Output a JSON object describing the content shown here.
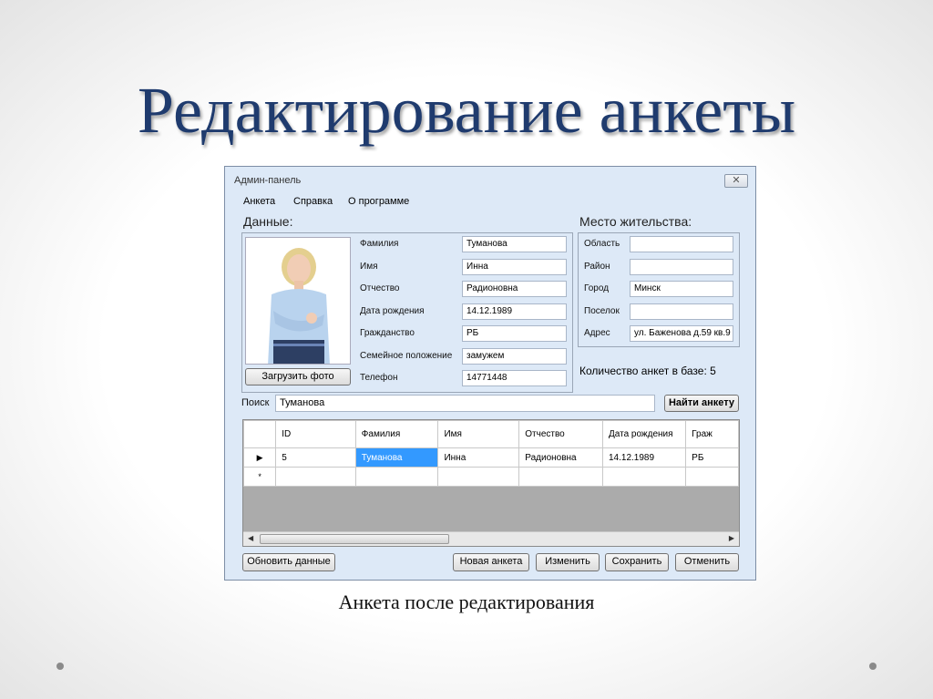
{
  "slide": {
    "title": "Редактирование анкеты",
    "caption": "Анкета после редактирования"
  },
  "window": {
    "title": "Админ-панель",
    "close_icon": "close-icon",
    "close_glyph": "✕"
  },
  "menu": [
    "Анкета",
    "Справка",
    "О программе"
  ],
  "data_group": {
    "label": "Данные:",
    "upload_button": "Загрузить фото",
    "fields": [
      {
        "label": "Фамилия",
        "value": "Туманова"
      },
      {
        "label": "Имя",
        "value": "Инна"
      },
      {
        "label": "Отчество",
        "value": "Радионовна"
      },
      {
        "label": "Дата рождения",
        "value": "14.12.1989"
      },
      {
        "label": "Гражданство",
        "value": "РБ"
      },
      {
        "label": "Семейное положение",
        "value": "замужем"
      },
      {
        "label": "Телефон",
        "value": "14771448"
      }
    ]
  },
  "address_group": {
    "label": "Место жительства:",
    "fields": [
      {
        "label": "Область",
        "value": ""
      },
      {
        "label": "Район",
        "value": ""
      },
      {
        "label": "Город",
        "value": "Минск"
      },
      {
        "label": "Поселок",
        "value": ""
      },
      {
        "label": "Адрес",
        "value": "ул. Баженова д.59 кв.9"
      }
    ]
  },
  "count": {
    "label": "Количество анкет в базе:",
    "value": "5"
  },
  "search": {
    "label": "Поиск",
    "value": "Туманова",
    "button": "Найти анкету"
  },
  "grid": {
    "columns": [
      "ID",
      "Фамилия",
      "Имя",
      "Отчество",
      "Дата рождения",
      "Граж"
    ],
    "rows": [
      {
        "marker": "▶",
        "cells": [
          "5",
          "Туманова",
          "Инна",
          "Радионовна",
          "14.12.1989",
          "РБ"
        ]
      },
      {
        "marker": "*",
        "cells": [
          "",
          "",
          "",
          "",
          "",
          ""
        ]
      }
    ]
  },
  "buttons": {
    "refresh": "Обновить данные",
    "new": "Новая анкета",
    "edit": "Изменить",
    "save": "Сохранить",
    "cancel": "Отменить"
  },
  "colors": {
    "title": "#1f3b6e",
    "window_bg": "#dde9f7",
    "selection": "#3399ff"
  }
}
